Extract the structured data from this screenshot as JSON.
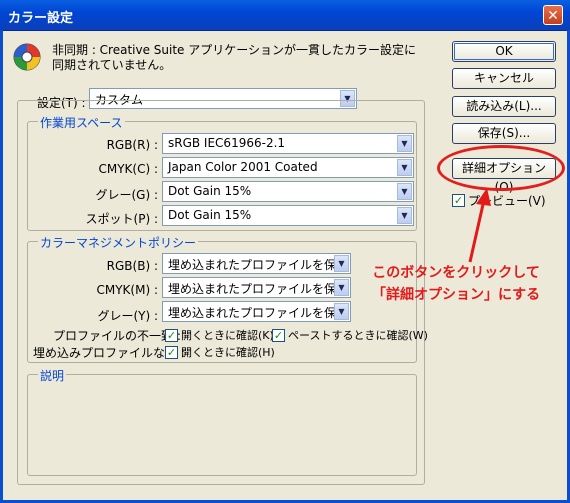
{
  "window": {
    "title": "カラー設定",
    "close": "✕"
  },
  "warning": {
    "line1": "非同期 : Creative Suite アプリケーションが一貫したカラー設定に",
    "line2": "同期されていません。"
  },
  "buttons": {
    "ok": "OK",
    "cancel": "キャンセル",
    "load": "読み込み(L)...",
    "save": "保存(S)...",
    "advanced": "詳細オプション(O)"
  },
  "preview": {
    "label": "プレビュー(V)",
    "checked": true
  },
  "settings": {
    "label": "設定(T) :",
    "value": "カスタム"
  },
  "working_spaces": {
    "title": "作業用スペース",
    "rows": [
      {
        "label": "RGB(R) :",
        "value": "sRGB IEC61966-2.1"
      },
      {
        "label": "CMYK(C) :",
        "value": "Japan Color 2001 Coated"
      },
      {
        "label": "グレー(G) :",
        "value": "Dot Gain 15%"
      },
      {
        "label": "スポット(P) :",
        "value": "Dot Gain 15%"
      }
    ]
  },
  "color_management": {
    "title": "カラーマネジメントポリシー",
    "rows": [
      {
        "label": "RGB(B) :",
        "value": "埋め込まれたプロファイルを保持"
      },
      {
        "label": "CMYK(M) :",
        "value": "埋め込まれたプロファイルを保持"
      },
      {
        "label": "グレー(Y) :",
        "value": "埋め込まれたプロファイルを保持"
      }
    ],
    "mismatch_label": "プロファイルの不一致 :",
    "mismatch_open": "開くときに確認(K)",
    "mismatch_paste": "ペーストするときに確認(W)",
    "missing_label": "埋め込みプロファイルなし :",
    "missing_open": "開くときに確認(H)"
  },
  "description": {
    "title": "説明"
  },
  "annotation": {
    "line1": "このボタンをクリックして",
    "line2": "「詳細オプション」にする"
  },
  "colors": {
    "annotation": "#e21a1a",
    "titlebar": "#0046d5"
  }
}
